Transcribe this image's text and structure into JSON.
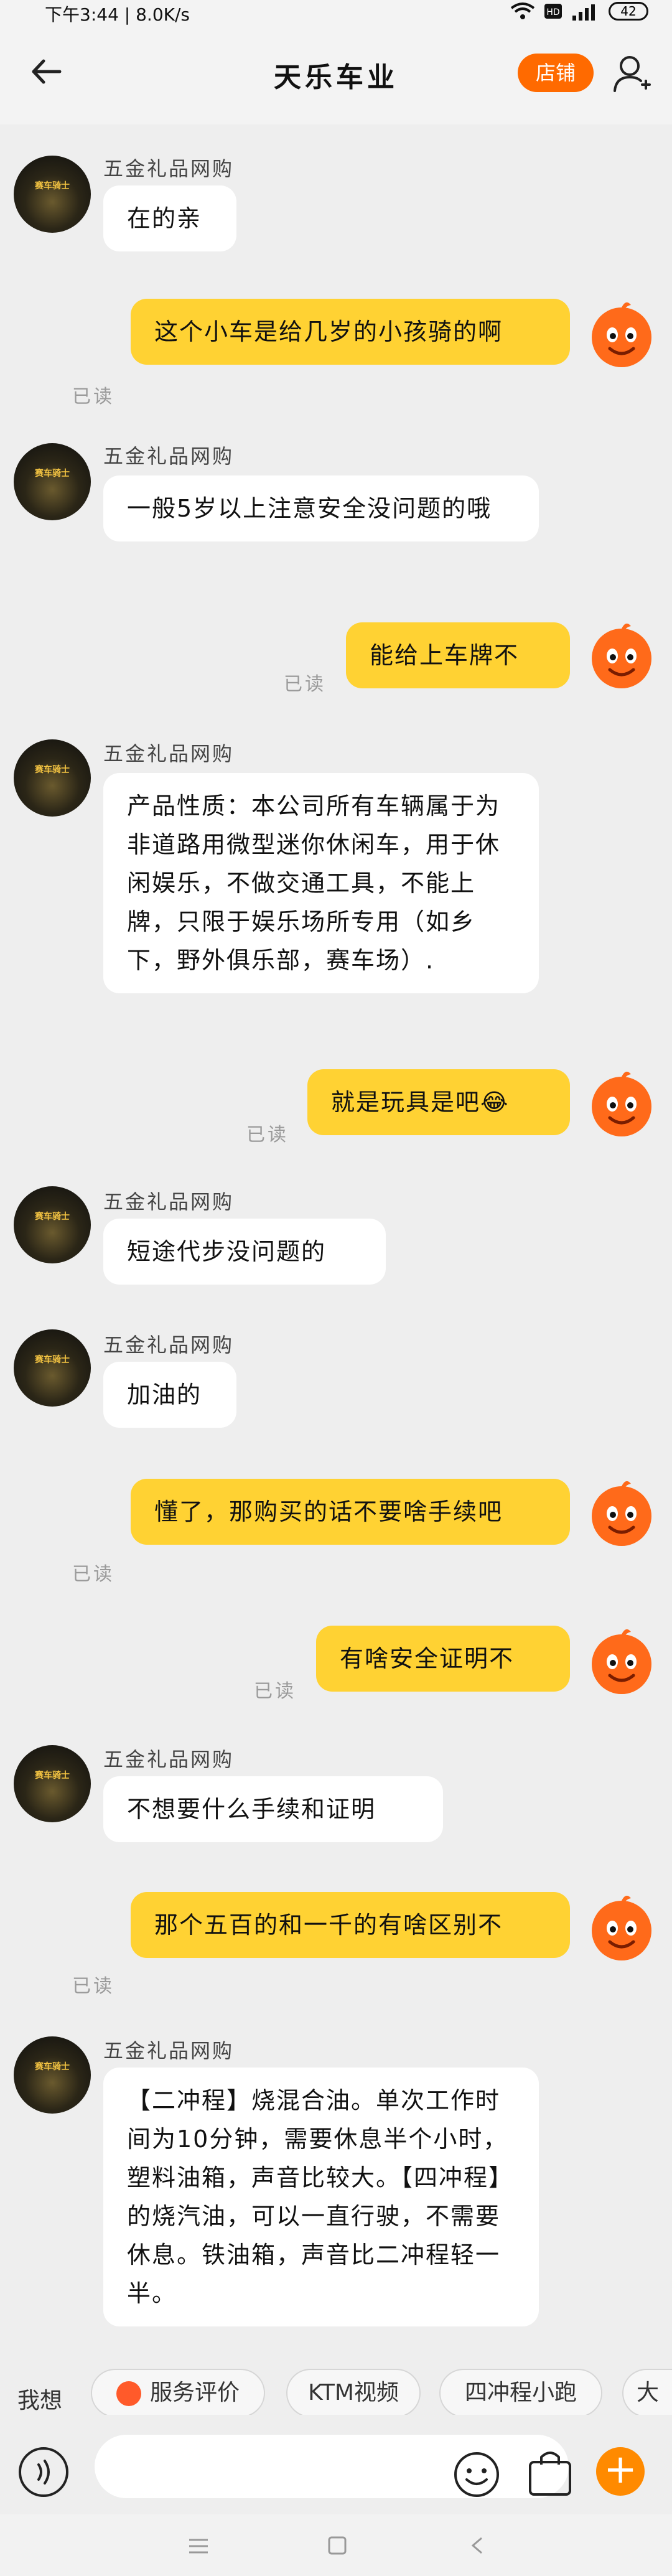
{
  "status_bar": {
    "time_speed": "下午3:44 | 8.0K/s",
    "battery": "42"
  },
  "header": {
    "title": "天乐车业",
    "shop_button": "店铺"
  },
  "messages": [
    {
      "sender": "五金礼品网购",
      "text": "在的亲"
    },
    {
      "text": "这个小车是给几岁的小孩骑的啊",
      "read": "已读"
    },
    {
      "sender": "五金礼品网购",
      "text": "一般5岁以上注意安全没问题的哦"
    },
    {
      "text": "能给上车牌不",
      "read": "已读"
    },
    {
      "sender": "五金礼品网购",
      "text": "产品性质：本公司所有车辆属于为非道路用微型迷你休闲车，用于休闲娱乐，不做交通工具，不能上牌，只限于娱乐场所专用（如乡下，野外俱乐部，赛车场）."
    },
    {
      "text": "就是玩具是吧😂",
      "read": "已读"
    },
    {
      "sender": "五金礼品网购",
      "text": "短途代步没问题的"
    },
    {
      "sender": "五金礼品网购",
      "text": "加油的"
    },
    {
      "text": "懂了，那购买的话不要啥手续吧",
      "read": "已读"
    },
    {
      "text": "有啥安全证明不",
      "read": "已读"
    },
    {
      "sender": "五金礼品网购",
      "text": "不想要什么手续和证明"
    },
    {
      "text": "那个五百的和一千的有啥区别不",
      "read": "已读"
    },
    {
      "sender": "五金礼品网购",
      "text": "【二冲程】烧混合油。单次工作时间为10分钟，需要休息半个小时，塑料油箱，声音比较大。【四冲程】的烧汽油，可以一直行驶，不需要休息。铁油箱，声音比二冲程轻一半。"
    }
  ],
  "quick_bar": {
    "label": "我想",
    "chips": [
      "服务评价",
      "KTM视频",
      "四冲程小跑",
      "大"
    ]
  },
  "composer": {
    "placeholder": ""
  },
  "colors": {
    "accent": "#ff6a00",
    "user_bubble": "#ffd233",
    "bot_bubble": "#ffffff",
    "background": "#eeeeee"
  },
  "icons": [
    "back-arrow-icon",
    "person-icon",
    "voice-icon",
    "emoji-icon",
    "shopping-bag-icon",
    "plus-icon",
    "menu-icon",
    "home-icon",
    "back-icon"
  ]
}
